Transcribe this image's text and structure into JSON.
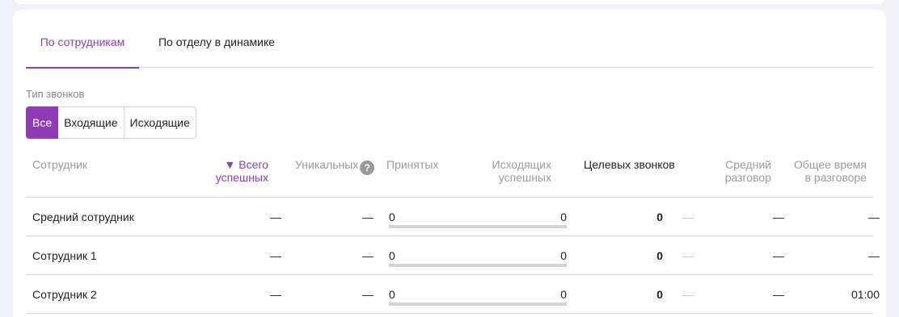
{
  "tabs": [
    {
      "label": "По сотрудникам",
      "active": true
    },
    {
      "label": "По отделу в динамике",
      "active": false
    }
  ],
  "filter": {
    "label": "Тип звонков",
    "options": [
      "Все",
      "Входящие",
      "Исходящие"
    ],
    "selected": "Все"
  },
  "columns": {
    "employee": "Сотрудник",
    "total_success_line1": "▼ Всего",
    "total_success_line2": "успешных",
    "unique": "Уникальных",
    "accepted": "Принятых",
    "outgoing_line1": "Исходящих",
    "outgoing_line2": "успешных",
    "target": "Целевых звонков",
    "avg_line1": "Средний",
    "avg_line2": "разговор",
    "total_time_line1": "Общее время",
    "total_time_line2": "в разговоре"
  },
  "rows": [
    {
      "name": "Средний сотрудник",
      "total": "—",
      "unique": "—",
      "accepted": "0",
      "outgoing": "0",
      "target": "0",
      "target_extra": "—",
      "avg": "—",
      "total_time": "—"
    },
    {
      "name": "Сотрудник 1",
      "total": "—",
      "unique": "—",
      "accepted": "0",
      "outgoing": "0",
      "target": "0",
      "target_extra": "—",
      "avg": "—",
      "total_time": "—"
    },
    {
      "name": "Сотрудник 2",
      "total": "—",
      "unique": "—",
      "accepted": "0",
      "outgoing": "0",
      "target": "0",
      "target_extra": "—",
      "avg": "—",
      "total_time": "01:00"
    }
  ],
  "colors": {
    "accent": "#8e3bb5",
    "divider": "#dcdcdc",
    "bar": "#d4d4d4"
  },
  "icons": {
    "help": "question-circle-icon"
  }
}
